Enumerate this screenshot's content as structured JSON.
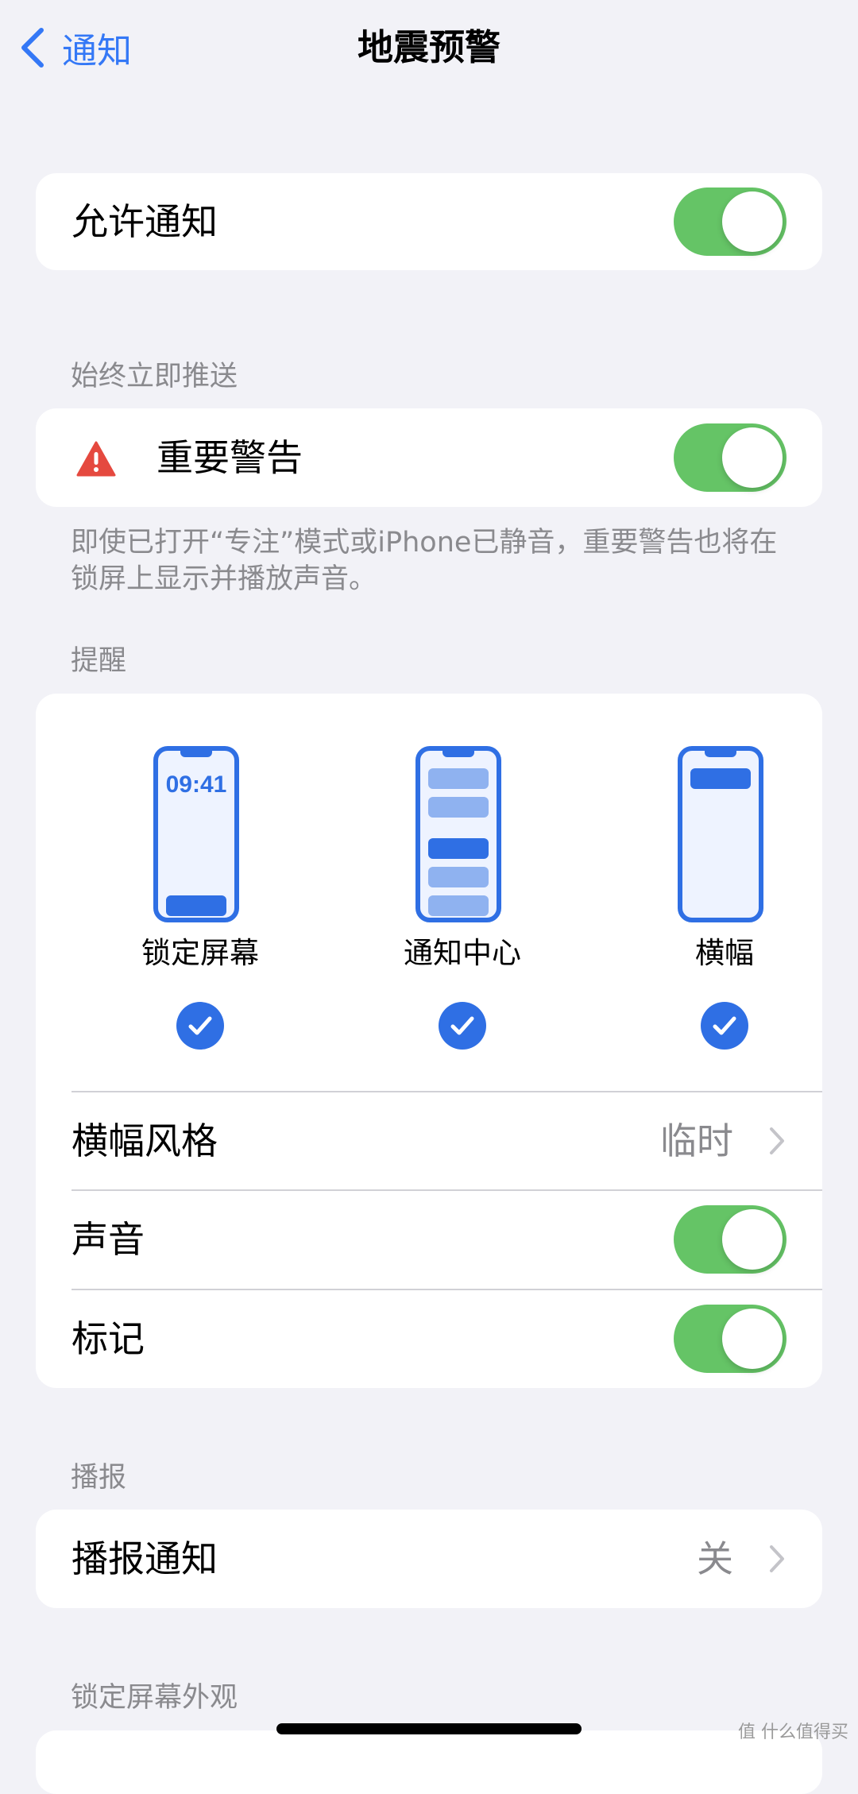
{
  "nav": {
    "back_label": "通知",
    "title": "地震预警"
  },
  "allow_notifications": {
    "label": "允许通知",
    "enabled": true
  },
  "critical": {
    "header": "始终立即推送",
    "label": "重要警告",
    "enabled": true,
    "footnote": "即使已打开“专注”模式或iPhone已静音，重要警告也将在锁屏上显示并播放声音。",
    "icon": "warning-triangle-icon",
    "icon_color": "#e5493f"
  },
  "alerts": {
    "header": "提醒",
    "styles": [
      {
        "label": "锁定屏幕",
        "preview_time": "09:41",
        "checked": true
      },
      {
        "label": "通知中心",
        "checked": true
      },
      {
        "label": "横幅",
        "checked": true
      }
    ],
    "banner_style": {
      "label": "横幅风格",
      "value": "临时"
    },
    "sounds": {
      "label": "声音",
      "enabled": true
    },
    "badges": {
      "label": "标记",
      "enabled": true
    }
  },
  "announce": {
    "header": "播报",
    "label": "播报通知",
    "value": "关"
  },
  "lock_screen": {
    "header": "锁定屏幕外观"
  },
  "watermark": "值 什么值得买",
  "colors": {
    "accent": "#3478f6",
    "toggle_on": "#65c466",
    "background": "#f2f2f7",
    "secondary_text": "#8a8a8e"
  }
}
